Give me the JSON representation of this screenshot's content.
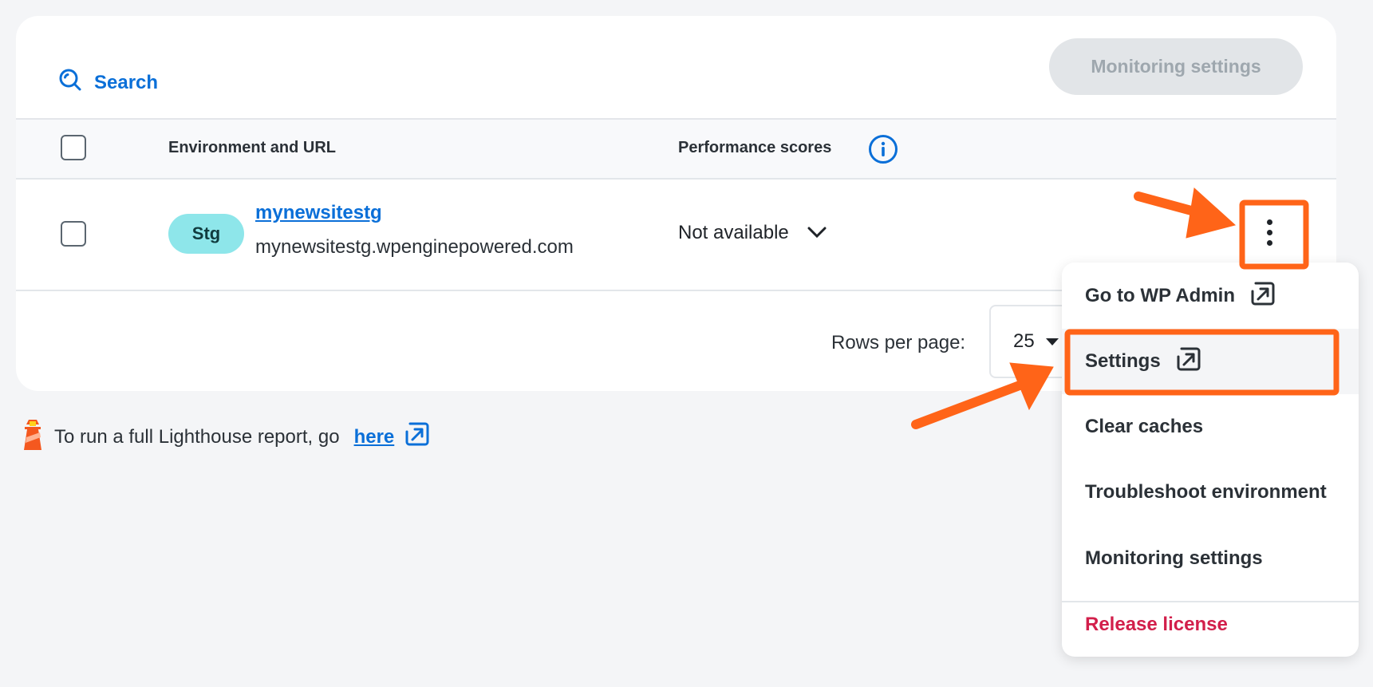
{
  "toolbar": {
    "search_label": "Search",
    "monitoring_button_label": "Monitoring settings"
  },
  "table": {
    "columns": [
      {
        "label": "Environment and URL"
      },
      {
        "label": "Performance scores"
      }
    ],
    "rows": [
      {
        "environment_badge": "Stg",
        "site_name": "mynewsitestg",
        "site_url": "mynewsitestg.wpenginepowered.com",
        "performance": "Not available"
      }
    ]
  },
  "pagination": {
    "rows_per_page_label": "Rows per page:",
    "rows_per_page_value": "25"
  },
  "lighthouse": {
    "text": "To run a full Lighthouse report, go",
    "link_label": "here"
  },
  "row_menu": {
    "items": [
      {
        "label": "Go to WP Admin",
        "external": true
      },
      {
        "label": "Settings",
        "external": true,
        "highlighted": true
      },
      {
        "label": "Clear caches"
      },
      {
        "label": "Troubleshoot environment"
      },
      {
        "label": "Monitoring settings"
      },
      {
        "label": "Release license",
        "danger": true
      }
    ]
  },
  "colors": {
    "accent": "#0a6fd8",
    "badge_bg": "#8ee6ea",
    "danger": "#d21f4b",
    "annotation": "#ff6418"
  }
}
